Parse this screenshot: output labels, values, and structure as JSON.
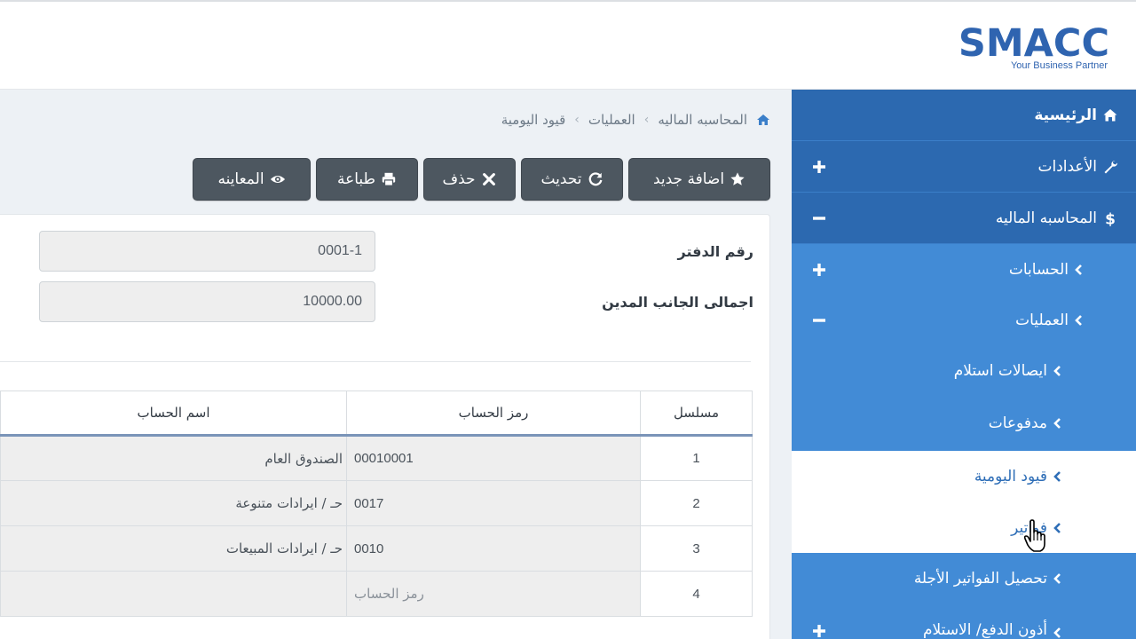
{
  "logo": {
    "main": "SMACC",
    "tagline": "Your Business Partner"
  },
  "breadcrumb": {
    "items": [
      "المحاسبه الماليه",
      "العمليات",
      "قيود اليومية"
    ],
    "separator": "›"
  },
  "toolbar": {
    "add_label": "اضافة جديد",
    "refresh_label": "تحديث",
    "delete_label": "حذف",
    "print_label": "طباعة",
    "preview_label": "المعاينه"
  },
  "form": {
    "book_number_label": "رقم الدفتر",
    "book_number_value": "0001-1",
    "debit_total_label": "اجمالى الجانب المدين",
    "debit_total_value": "10000.00"
  },
  "table": {
    "headers": {
      "serial": "مسلسل",
      "code": "رمز الحساب",
      "name": "اسم الحساب"
    },
    "rows": [
      {
        "serial": "1",
        "code": "00010001",
        "name": "الصندوق العام"
      },
      {
        "serial": "2",
        "code": "0017",
        "name": "حـ / ايرادات متنوعة"
      },
      {
        "serial": "3",
        "code": "0010",
        "name": "حـ / ايرادات المبيعات"
      },
      {
        "serial": "4",
        "code": "رمز الحساب",
        "name": ""
      }
    ]
  },
  "sidebar": {
    "home": "الرئيسية",
    "settings": "الأعدادات",
    "finance": "المحاسبه الماليه",
    "accounts": "الحسابات",
    "operations": "العمليات",
    "receipts": "ايصالات استلام",
    "payments": "مدفوعات",
    "journal": "قيود اليومية",
    "invoices": "فواتير",
    "deferred": "تحصيل الفواتير الأجلة",
    "vouchers": "أذون الدفع/ الاستلام"
  },
  "colors": {
    "brand": "#2f64b0",
    "sidebar_top": "#2c69b0",
    "sidebar_sub": "#428bd6",
    "button": "#4d5760"
  }
}
